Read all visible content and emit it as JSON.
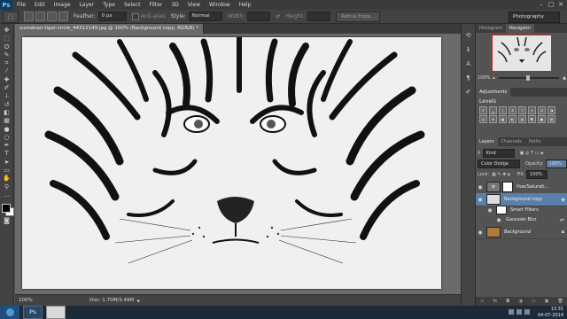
{
  "app": {
    "logo": "Ps"
  },
  "menu": [
    "File",
    "Edit",
    "Image",
    "Layer",
    "Type",
    "Select",
    "Filter",
    "3D",
    "View",
    "Window",
    "Help"
  ],
  "window_controls": [
    "–",
    "□",
    "✕"
  ],
  "options": {
    "feather_label": "Feather:",
    "feather_value": "0 px",
    "antialias_label": "Anti-alias",
    "style_label": "Style:",
    "style_value": "Normal",
    "width_label": "Width:",
    "height_label": "Height:",
    "refine_edge": "Refine Edge...",
    "workspace": "Photography"
  },
  "document": {
    "tab_title": "sumatran-tiger-circle_44312149.jpg @ 100% (Background copy, RGB/8) *",
    "zoom": "100%",
    "doc_info": "Doc: 1.70M/3.49M"
  },
  "panels": {
    "top_tabs": [
      "Histogram",
      "Navigator"
    ],
    "navigator_zoom": "100%",
    "adjustments_tab": "Adjustments",
    "levels_title": "Levels",
    "layer_tabs": [
      "Layers",
      "Channels",
      "Paths"
    ],
    "kind_label": "Kind",
    "blend_mode": "Color Dodge",
    "opacity_label": "Opacity:",
    "opacity_value": "100%",
    "lock_label": "Lock:",
    "fill_label": "Fill:",
    "fill_value": "100%",
    "layers": [
      {
        "name": "Hue/Saturati...",
        "type": "adjustment"
      },
      {
        "name": "Background copy",
        "type": "smart"
      },
      {
        "name": "Smart Filters",
        "type": "filter-group"
      },
      {
        "name": "Gaussian Blur",
        "type": "filter"
      },
      {
        "name": "Background",
        "type": "locked"
      }
    ]
  },
  "taskbar": {
    "ps_button": "Ps",
    "time": "13:31",
    "date": "04-07-2014"
  },
  "colors": {
    "accent": "#5a7fa8",
    "ps_blue": "#7ec7ff",
    "canvas_bg": "#6b6b6b"
  }
}
